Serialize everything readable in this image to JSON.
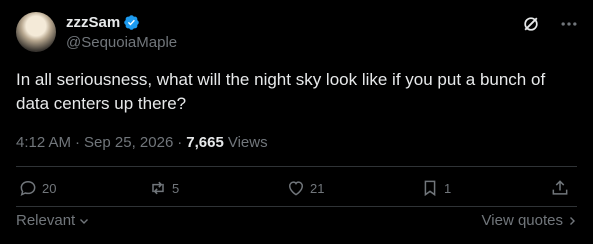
{
  "author": {
    "display_name": "zzzSam",
    "handle": "@SequoiaMaple",
    "verified": true
  },
  "tweet": {
    "text": "In all seriousness, what will the night sky look like if you put a bunch of data centers up there?",
    "time": "4:12 AM",
    "separator": "·",
    "date": "Sep 25, 2026",
    "views_count": "7,665",
    "views_label": "Views"
  },
  "actions": {
    "replies": "20",
    "reposts": "5",
    "likes": "21",
    "bookmarks": "1"
  },
  "footer": {
    "sort_label": "Relevant",
    "view_quotes_label": "View quotes"
  },
  "colors": {
    "background": "#000000",
    "text": "#e7e9ea",
    "muted": "#71767b",
    "verified": "#1d9bf0",
    "divider": "#2f3336"
  },
  "icons": [
    "verified-badge-icon",
    "grok-icon",
    "more-icon",
    "reply-icon",
    "repost-icon",
    "like-icon",
    "bookmark-icon",
    "share-icon",
    "chevron-down-icon",
    "chevron-right-icon"
  ]
}
